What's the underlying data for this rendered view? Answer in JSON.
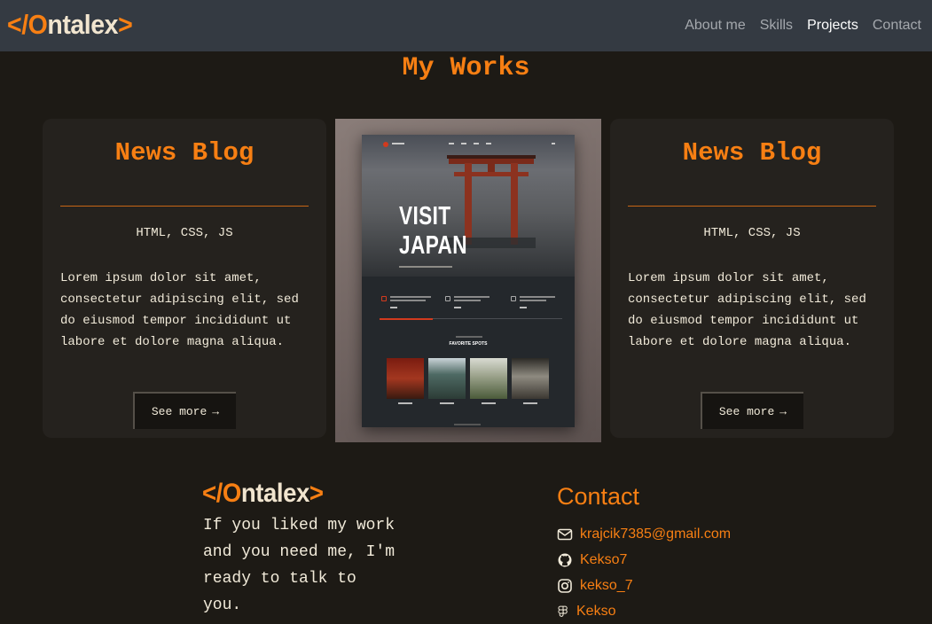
{
  "brand": {
    "open": "</",
    "o": "O",
    "rest": "ntalex",
    "close": ">"
  },
  "nav": {
    "links": [
      {
        "label": "About me",
        "active": false
      },
      {
        "label": "Skills",
        "active": false
      },
      {
        "label": "Projects",
        "active": true
      },
      {
        "label": "Contact",
        "active": false
      }
    ]
  },
  "works": {
    "title": "My Works",
    "cards": [
      {
        "title": "News Blog",
        "tech": "HTML, CSS, JS",
        "description": "Lorem ipsum dolor sit amet, consectetur adipiscing elit, sed do eiusmod tempor incididunt ut labore et dolore magna aliqua.",
        "button": "See more",
        "button_arrow": "→"
      },
      {
        "title": "News Blog",
        "tech": "HTML, CSS, JS",
        "description": "Lorem ipsum dolor sit amet, consectetur adipiscing elit, sed do eiusmod tempor incididunt ut labore et dolore magna aliqua.",
        "button": "See more",
        "button_arrow": "→"
      }
    ],
    "preview": {
      "headline_1": "VISIT",
      "headline_2": "JAPAN",
      "section_heading": "FAVORITE SPOTS"
    }
  },
  "footer": {
    "text": "If you liked my work and you need me, I'm ready to talk to you.",
    "contact_title": "Contact",
    "contacts": [
      {
        "icon": "envelope-icon",
        "label": "krajcik7385@gmail.com"
      },
      {
        "icon": "github-icon",
        "label": "Kekso7"
      },
      {
        "icon": "instagram-icon",
        "label": "kekso_7"
      },
      {
        "icon": "figma-icon",
        "label": "Kekso"
      }
    ]
  },
  "colors": {
    "accent": "#f77f13",
    "background": "#1d1a15",
    "nav": "#343a42",
    "card": "#25221e"
  }
}
